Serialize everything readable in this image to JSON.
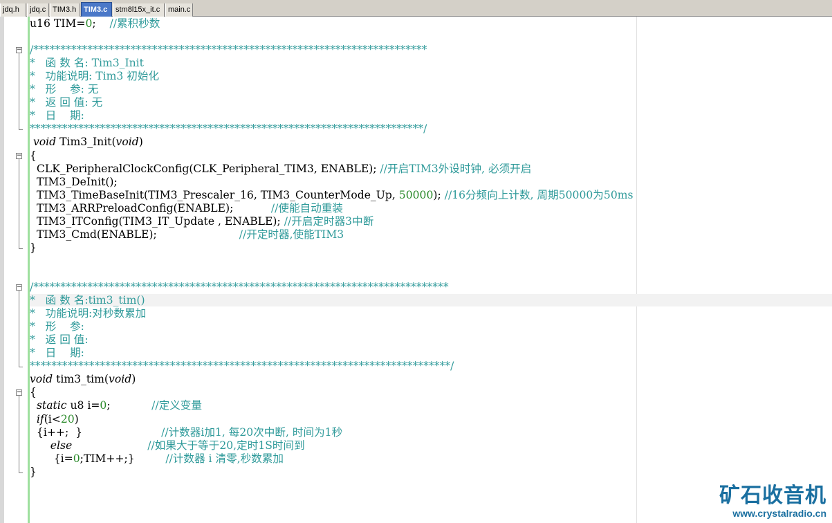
{
  "tabs": [
    {
      "label": "jdq.h",
      "active": false
    },
    {
      "label": "jdq.c",
      "active": false
    },
    {
      "label": "TIM3.h",
      "active": false
    },
    {
      "label": "TIM3.c",
      "active": true
    },
    {
      "label": "stm8l15x_it.c",
      "active": false
    },
    {
      "label": "main.c",
      "active": false
    }
  ],
  "code": [
    {
      "parts": [
        [
          "n",
          "u16 TIM="
        ],
        [
          "num",
          "0"
        ],
        [
          "n",
          ";    "
        ],
        [
          "cmt",
          "//累积秒数"
        ]
      ]
    },
    {
      "parts": [
        [
          "n",
          ""
        ]
      ]
    },
    {
      "parts": [
        [
          "star",
          "/*************************************************************************"
        ]
      ]
    },
    {
      "parts": [
        [
          "star",
          "*   函 数 名: Tim3_Init"
        ]
      ]
    },
    {
      "parts": [
        [
          "star",
          "*   功能说明: Tim3 初始化"
        ]
      ]
    },
    {
      "parts": [
        [
          "star",
          "*   形    参: 无"
        ]
      ]
    },
    {
      "parts": [
        [
          "star",
          "*   返 回 值: 无"
        ]
      ]
    },
    {
      "parts": [
        [
          "star",
          "*   日    期:"
        ]
      ]
    },
    {
      "parts": [
        [
          "star",
          "*************************************************************************/"
        ]
      ]
    },
    {
      "parts": [
        [
          "n",
          " "
        ],
        [
          "kw",
          "void"
        ],
        [
          "n",
          " Tim3_Init("
        ],
        [
          "kw",
          "void"
        ],
        [
          "n",
          ")"
        ]
      ]
    },
    {
      "parts": [
        [
          "n",
          "{"
        ]
      ]
    },
    {
      "parts": [
        [
          "n",
          "  CLK_PeripheralClockConfig(CLK_Peripheral_TIM3, ENABLE); "
        ],
        [
          "cmt",
          "//开启TIM3外设时钟, 必须开启"
        ]
      ]
    },
    {
      "parts": [
        [
          "n",
          "  TIM3_DeInit();"
        ]
      ]
    },
    {
      "parts": [
        [
          "n",
          "  TIM3_TimeBaseInit(TIM3_Prescaler_16, TIM3_CounterMode_Up, "
        ],
        [
          "num",
          "50000"
        ],
        [
          "n",
          "); "
        ],
        [
          "cmt",
          "//16分频向上计数, 周期50000为50ms"
        ]
      ]
    },
    {
      "parts": [
        [
          "n",
          "  TIM3_ARRPreloadConfig(ENABLE);           "
        ],
        [
          "cmt",
          "//使能自动重装"
        ]
      ]
    },
    {
      "parts": [
        [
          "n",
          "  TIM3_ITConfig(TIM3_IT_Update , ENABLE); "
        ],
        [
          "cmt",
          "//开启定时器3中断"
        ]
      ]
    },
    {
      "parts": [
        [
          "n",
          "  TIM3_Cmd(ENABLE);                        "
        ],
        [
          "cmt",
          "//开定时器,使能TIM3"
        ]
      ]
    },
    {
      "parts": [
        [
          "n",
          "}"
        ]
      ]
    },
    {
      "parts": [
        [
          "n",
          ""
        ]
      ]
    },
    {
      "parts": [
        [
          "n",
          ""
        ]
      ]
    },
    {
      "parts": [
        [
          "star",
          "/*****************************************************************************"
        ]
      ]
    },
    {
      "parts": [
        [
          "star",
          "*   函 数 名:tim3_tim()"
        ]
      ]
    },
    {
      "parts": [
        [
          "star",
          "*   功能说明:对秒数累加"
        ]
      ]
    },
    {
      "parts": [
        [
          "star",
          "*   形    参:"
        ]
      ]
    },
    {
      "parts": [
        [
          "star",
          "*   返 回 值:"
        ]
      ]
    },
    {
      "parts": [
        [
          "star",
          "*   日    期:"
        ]
      ]
    },
    {
      "parts": [
        [
          "star",
          "******************************************************************************/"
        ]
      ]
    },
    {
      "parts": [
        [
          "kw",
          "void"
        ],
        [
          "n",
          " tim3_tim("
        ],
        [
          "kw",
          "void"
        ],
        [
          "n",
          ")"
        ]
      ]
    },
    {
      "parts": [
        [
          "n",
          "{"
        ]
      ]
    },
    {
      "parts": [
        [
          "n",
          "  "
        ],
        [
          "kw",
          "static"
        ],
        [
          "n",
          " u8 i="
        ],
        [
          "num",
          "0"
        ],
        [
          "n",
          ";            "
        ],
        [
          "cmt",
          "//定义变量"
        ]
      ]
    },
    {
      "parts": [
        [
          "n",
          "  "
        ],
        [
          "kw",
          "if"
        ],
        [
          "n",
          "(i<"
        ],
        [
          "num",
          "20"
        ],
        [
          "n",
          ")"
        ]
      ]
    },
    {
      "parts": [
        [
          "n",
          "  {i++;  }                       "
        ],
        [
          "cmt",
          "//计数器i加1, 每20次中断, 时间为1秒"
        ]
      ]
    },
    {
      "parts": [
        [
          "n",
          "      "
        ],
        [
          "kw",
          "else"
        ],
        [
          "n",
          "                      "
        ],
        [
          "cmt",
          "//如果大于等于20,定时1S时间到"
        ]
      ]
    },
    {
      "parts": [
        [
          "n",
          "       {i="
        ],
        [
          "num",
          "0"
        ],
        [
          "n",
          ";TIM++;}         "
        ],
        [
          "cmt",
          "//计数器 i 清零,秒数累加"
        ]
      ]
    },
    {
      "parts": [
        [
          "n",
          "}"
        ]
      ]
    }
  ],
  "watermark": {
    "title": "矿石收音机",
    "url": "www.crystalradio.cn"
  }
}
